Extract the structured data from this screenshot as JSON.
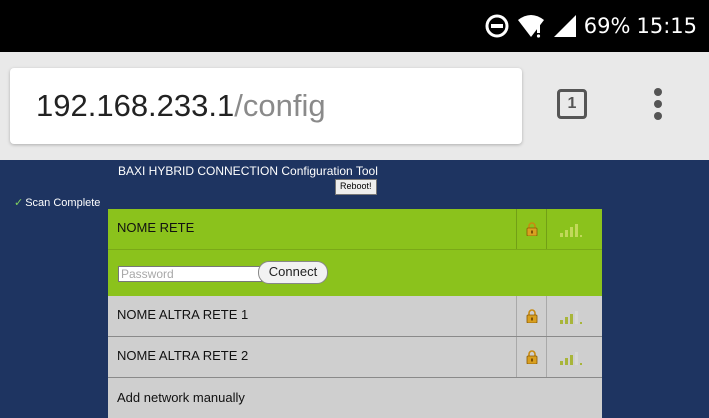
{
  "status_bar": {
    "battery": "69%",
    "time": "15:15"
  },
  "browser": {
    "url_host": "192.168.233.1",
    "url_path": "/config",
    "tab_count": "1"
  },
  "page": {
    "title": "BAXI HYBRID CONNECTION Configuration Tool",
    "reboot_label": "Reboot!",
    "scan_status": "Scan Complete",
    "networks": [
      {
        "name": "NOME RETE",
        "locked": true,
        "selected": true
      },
      {
        "name": "NOME ALTRA RETE 1",
        "locked": true,
        "selected": false
      },
      {
        "name": "NOME ALTRA RETE 2",
        "locked": true,
        "selected": false
      }
    ],
    "password_placeholder": "Password",
    "connect_label": "Connect",
    "add_network_label": "Add network manually"
  },
  "colors": {
    "page_bg": "#1e3461",
    "selected_row": "#8bc21c",
    "row_bg": "#cfcfcf"
  }
}
